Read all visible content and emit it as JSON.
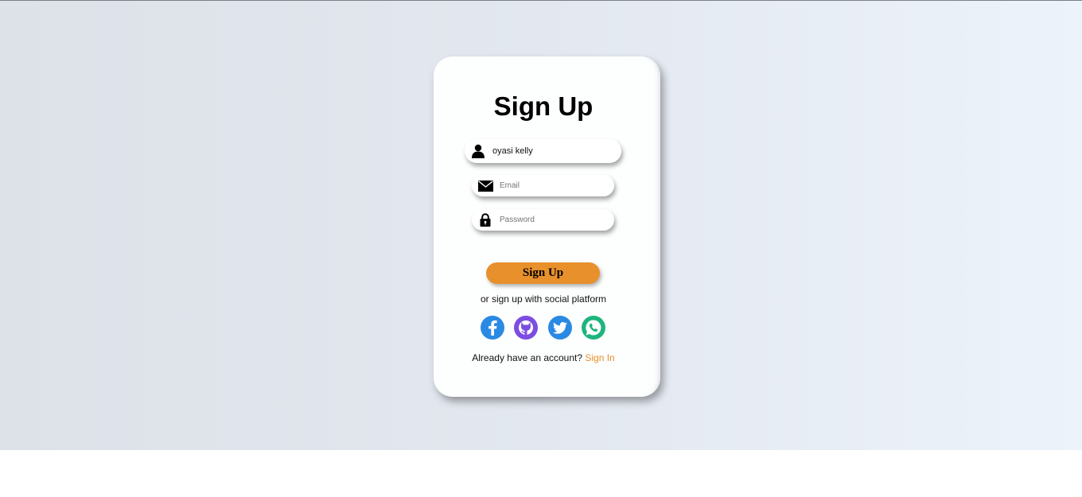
{
  "form": {
    "title": "Sign Up",
    "name_value": "oyasi kelly",
    "email_placeholder": "Email",
    "password_placeholder": "Password",
    "submit_label": "Sign Up",
    "social_text": "or sign up with social platform",
    "account_text": "Already have an account?",
    "signin_link": "Sign In"
  },
  "socials": [
    {
      "name": "facebook-icon",
      "color": "#2a8ae3"
    },
    {
      "name": "github-icon",
      "color": "#7b4de2"
    },
    {
      "name": "twitter-icon",
      "color": "#2a8ae3"
    },
    {
      "name": "whatsapp-icon",
      "color": "#1eb57d"
    }
  ],
  "colors": {
    "accent": "#e8902b"
  }
}
